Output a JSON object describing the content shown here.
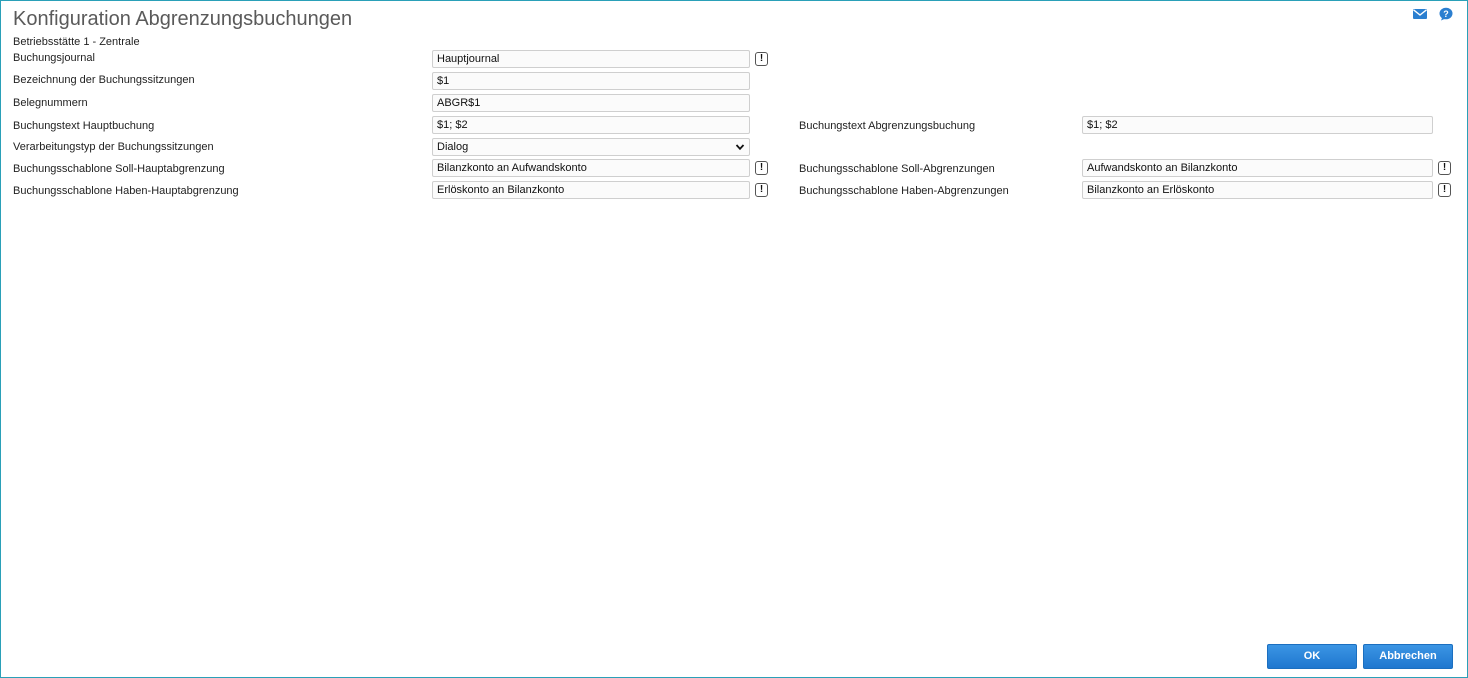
{
  "header": {
    "title": "Konfiguration Abgrenzungsbuchungen",
    "subtitle": "Betriebsstätte 1 - Zentrale",
    "icons": [
      "mail-icon",
      "help-icon"
    ]
  },
  "form": {
    "buchungsjournal": {
      "label": "Buchungsjournal",
      "value": "Hauptjournal"
    },
    "bezeichnung": {
      "label": "Bezeichnung der Buchungssitzungen",
      "value": "$1"
    },
    "belegnummern": {
      "label": "Belegnummern",
      "value": "ABGR$1"
    },
    "text_haupt": {
      "label": "Buchungstext Hauptbuchung",
      "value": "$1; $2"
    },
    "text_abgrenzung": {
      "label": "Buchungstext Abgrenzungsbuchung",
      "value": "$1; $2"
    },
    "verarbeitungstyp": {
      "label": "Verarbeitungstyp der Buchungssitzungen",
      "value": "Dialog"
    },
    "soll_haupt": {
      "label": "Buchungsschablone Soll-Hauptabgrenzung",
      "value": "Bilanzkonto an Aufwandskonto"
    },
    "soll_abgr": {
      "label": "Buchungsschablone Soll-Abgrenzungen",
      "value": "Aufwandskonto an Bilanzkonto"
    },
    "haben_haupt": {
      "label": "Buchungsschablone Haben-Hauptabgrenzung",
      "value": "Erlöskonto an Bilanzkonto"
    },
    "haben_abgr": {
      "label": "Buchungsschablone Haben-Abgrenzungen",
      "value": "Bilanzkonto an Erlöskonto"
    },
    "lookup_symbol": "!"
  },
  "footer": {
    "ok_label": "OK",
    "cancel_label": "Abbrechen"
  },
  "colors": {
    "accent": "#1f77cf",
    "frame": "#2aa0b8",
    "title": "#5a5a5a"
  }
}
